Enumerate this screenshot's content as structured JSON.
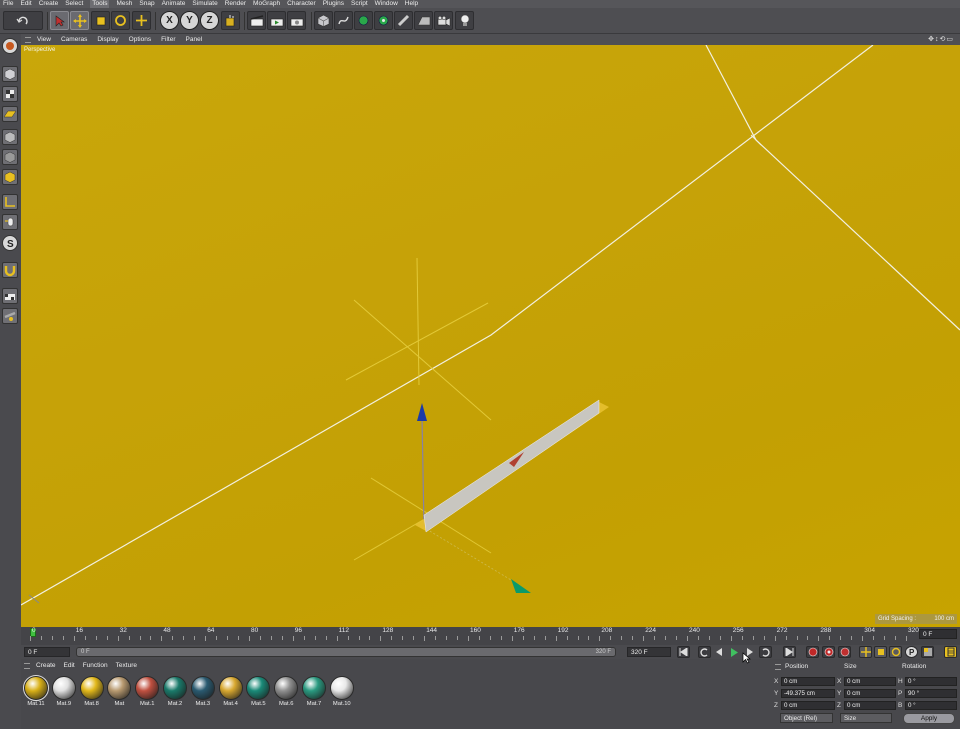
{
  "menu": [
    "File",
    "Edit",
    "Create",
    "Select",
    "Tools",
    "Mesh",
    "Snap",
    "Animate",
    "Simulate",
    "Render",
    "MoGraph",
    "Character",
    "Plugins",
    "Script",
    "Window",
    "Help"
  ],
  "menu_active": "Tools",
  "toolbar": {
    "axis_x": "X",
    "axis_y": "Y",
    "axis_z": "Z"
  },
  "viewport": {
    "menu": [
      "View",
      "Cameras",
      "Display",
      "Options",
      "Filter",
      "Panel"
    ],
    "label": "Perspective",
    "grid_spacing_label": "Grid Spacing :",
    "grid_spacing_value": "100 cm",
    "nav_icons": "✥↕⟲▭"
  },
  "timeline": {
    "ticks": [
      "0",
      "16",
      "32",
      "48",
      "64",
      "80",
      "96",
      "112",
      "128",
      "144",
      "160",
      "176",
      "192",
      "208",
      "224",
      "240",
      "256",
      "272",
      "288",
      "304",
      "320"
    ],
    "current_frame": "0 F"
  },
  "transport": {
    "start_field": "0 F",
    "slider_start": "0 F",
    "slider_end": "320 F",
    "end_field": "320 F"
  },
  "materials": {
    "menu": [
      "Create",
      "Edit",
      "Function",
      "Texture"
    ],
    "items": [
      {
        "name": "Mat.11",
        "color": "#d8b018"
      },
      {
        "name": "Mat.9",
        "color": "#e0e0e0"
      },
      {
        "name": "Mat.8",
        "color": "#e2b81a"
      },
      {
        "name": "Mat",
        "color": "#b89a70"
      },
      {
        "name": "Mat.1",
        "color": "#c05040"
      },
      {
        "name": "Mat.2",
        "color": "#1a7a6a"
      },
      {
        "name": "Mat.3",
        "color": "#2a5a70"
      },
      {
        "name": "Mat.4",
        "color": "#d8a830"
      },
      {
        "name": "Mat.5",
        "color": "#1a8a78"
      },
      {
        "name": "Mat.6",
        "color": "#909090"
      },
      {
        "name": "Mat.7",
        "color": "#2a9a80"
      },
      {
        "name": "Mat.10",
        "color": "#e8e8e8"
      }
    ]
  },
  "coordinates": {
    "position_label": "Position",
    "size_label": "Size",
    "rotation_label": "Rotation",
    "rows": [
      {
        "pos_axis": "X",
        "pos": "0 cm",
        "size_axis": "X",
        "size": "0 cm",
        "rot_axis": "H",
        "rot": "0 °"
      },
      {
        "pos_axis": "Y",
        "pos": "-49.375 cm",
        "size_axis": "Y",
        "size": "0 cm",
        "rot_axis": "P",
        "rot": "90 °"
      },
      {
        "pos_axis": "Z",
        "pos": "0 cm",
        "size_axis": "Z",
        "size": "0 cm",
        "rot_axis": "B",
        "rot": "0 °"
      }
    ],
    "mode_dropdown": "Object (Rel)",
    "size_dropdown": "Size",
    "apply_label": "Apply"
  },
  "colors": {
    "viewport_bg": "#c6a306",
    "accent_green": "#40c040"
  }
}
